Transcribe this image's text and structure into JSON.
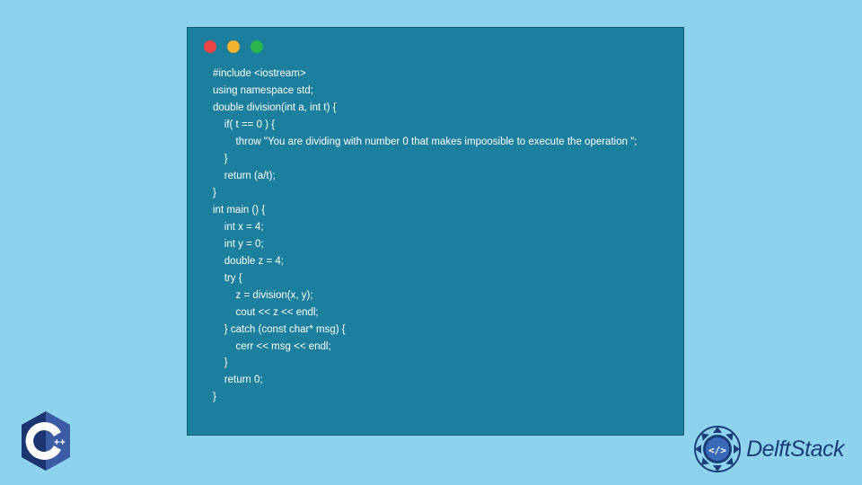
{
  "code": {
    "lines": [
      "#include <iostream>",
      "using namespace std;",
      "double division(int a, int t) {",
      "    if( t == 0 ) {",
      "        throw \"You are dividing with number 0 that makes impoosible to execute the operation \";",
      "    }",
      "    return (a/t);",
      "}",
      "int main () {",
      "    int x = 4;",
      "    int y = 0;",
      "    double z = 4;",
      "    try {",
      "        z = division(x, y);",
      "        cout << z << endl;",
      "    } catch (const char* msg) {",
      "        cerr << msg << endl;",
      "    }",
      "    return 0;",
      "}"
    ]
  },
  "branding": {
    "delftstack": "DelftStack",
    "cpp_label": "C++"
  },
  "colors": {
    "background": "#8ed3ed",
    "window_bg": "#1c7f9e",
    "text": "#ffffff",
    "brand_blue": "#1a3e7a"
  }
}
